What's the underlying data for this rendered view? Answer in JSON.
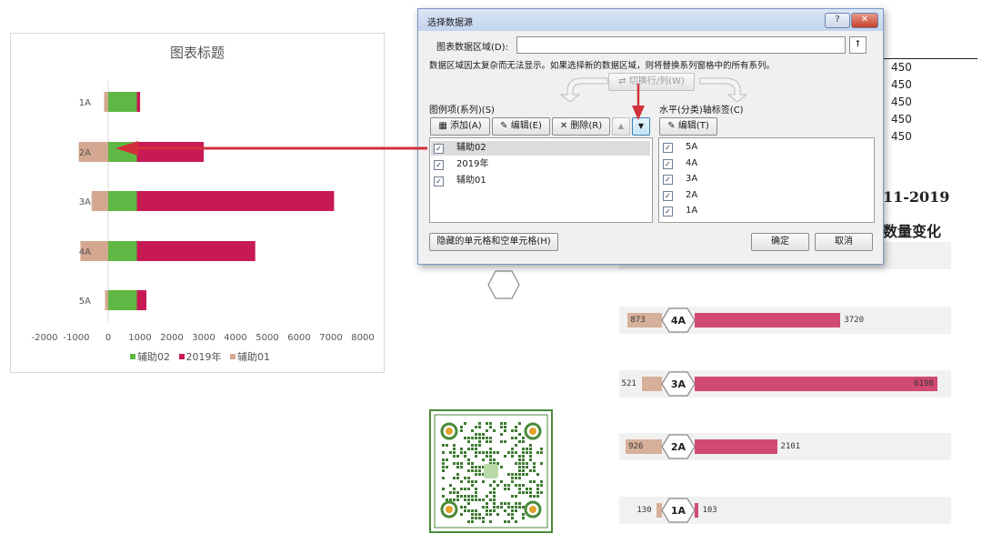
{
  "chart": {
    "title": "图表标题",
    "legend": [
      {
        "name": "辅助02",
        "color": "#5fb843"
      },
      {
        "name": "2019年",
        "color": "#c71a55"
      },
      {
        "name": "辅助01",
        "color": "#d4a890"
      }
    ]
  },
  "chart_data": {
    "type": "bar",
    "orientation": "horizontal",
    "stacked": true,
    "title": "图表标题",
    "categories": [
      "1A",
      "2A",
      "3A",
      "4A",
      "5A"
    ],
    "xlim": [
      -2000,
      8000
    ],
    "xticks": [
      "-2000",
      "-1000",
      "0",
      "1000",
      "2000",
      "3000",
      "4000",
      "5000",
      "6000",
      "7000",
      "8000"
    ],
    "series": [
      {
        "name": "辅助01",
        "values": [
          -130,
          -926,
          -521,
          -873,
          -100
        ]
      },
      {
        "name": "辅助02",
        "values": [
          900,
          900,
          900,
          900,
          900
        ]
      },
      {
        "name": "2019年",
        "values": [
          103,
          2101,
          6198,
          3720,
          300
        ]
      }
    ]
  },
  "sheet": {
    "values": [
      "450",
      "450",
      "450",
      "450",
      "450"
    ],
    "heading1": "11-2019",
    "heading2": "数量变化"
  },
  "infographic": {
    "rows": [
      {
        "label": "4A",
        "left": "873",
        "right": "3720",
        "left_val": 873,
        "right_val": 3720
      },
      {
        "label": "3A",
        "left": "521",
        "right": "6198",
        "left_val": 521,
        "right_val": 6198
      },
      {
        "label": "2A",
        "left": "926",
        "right": "2101",
        "left_val": 926,
        "right_val": 2101
      },
      {
        "label": "1A",
        "left": "130",
        "right": "103",
        "left_val": 130,
        "right_val": 103
      }
    ],
    "colors": {
      "left": "#d6b09a",
      "right": "#d04a72",
      "hex_border": "#888888"
    }
  },
  "dialog": {
    "title": "选择数据源",
    "help": "?",
    "close": "✕",
    "range_label": "图表数据区域(D):",
    "range_value": "",
    "info": "数据区域因太复杂而无法显示。如果选择新的数据区域，则将替换系列窗格中的所有系列。",
    "switch_btn": "切换行/列(W)",
    "legend_section": "图例项(系列)(S)",
    "axis_section": "水平(分类)轴标签(C)",
    "add_btn": "添加(A)",
    "edit_btn": "编辑(E)",
    "delete_btn": "删除(R)",
    "axis_edit_btn": "编辑(T)",
    "series_items": [
      "辅助02",
      "2019年",
      "辅助01"
    ],
    "axis_items": [
      "5A",
      "4A",
      "3A",
      "2A",
      "1A"
    ],
    "hidden_btn": "隐藏的单元格和空单元格(H)",
    "ok": "确定",
    "cancel": "取消"
  }
}
